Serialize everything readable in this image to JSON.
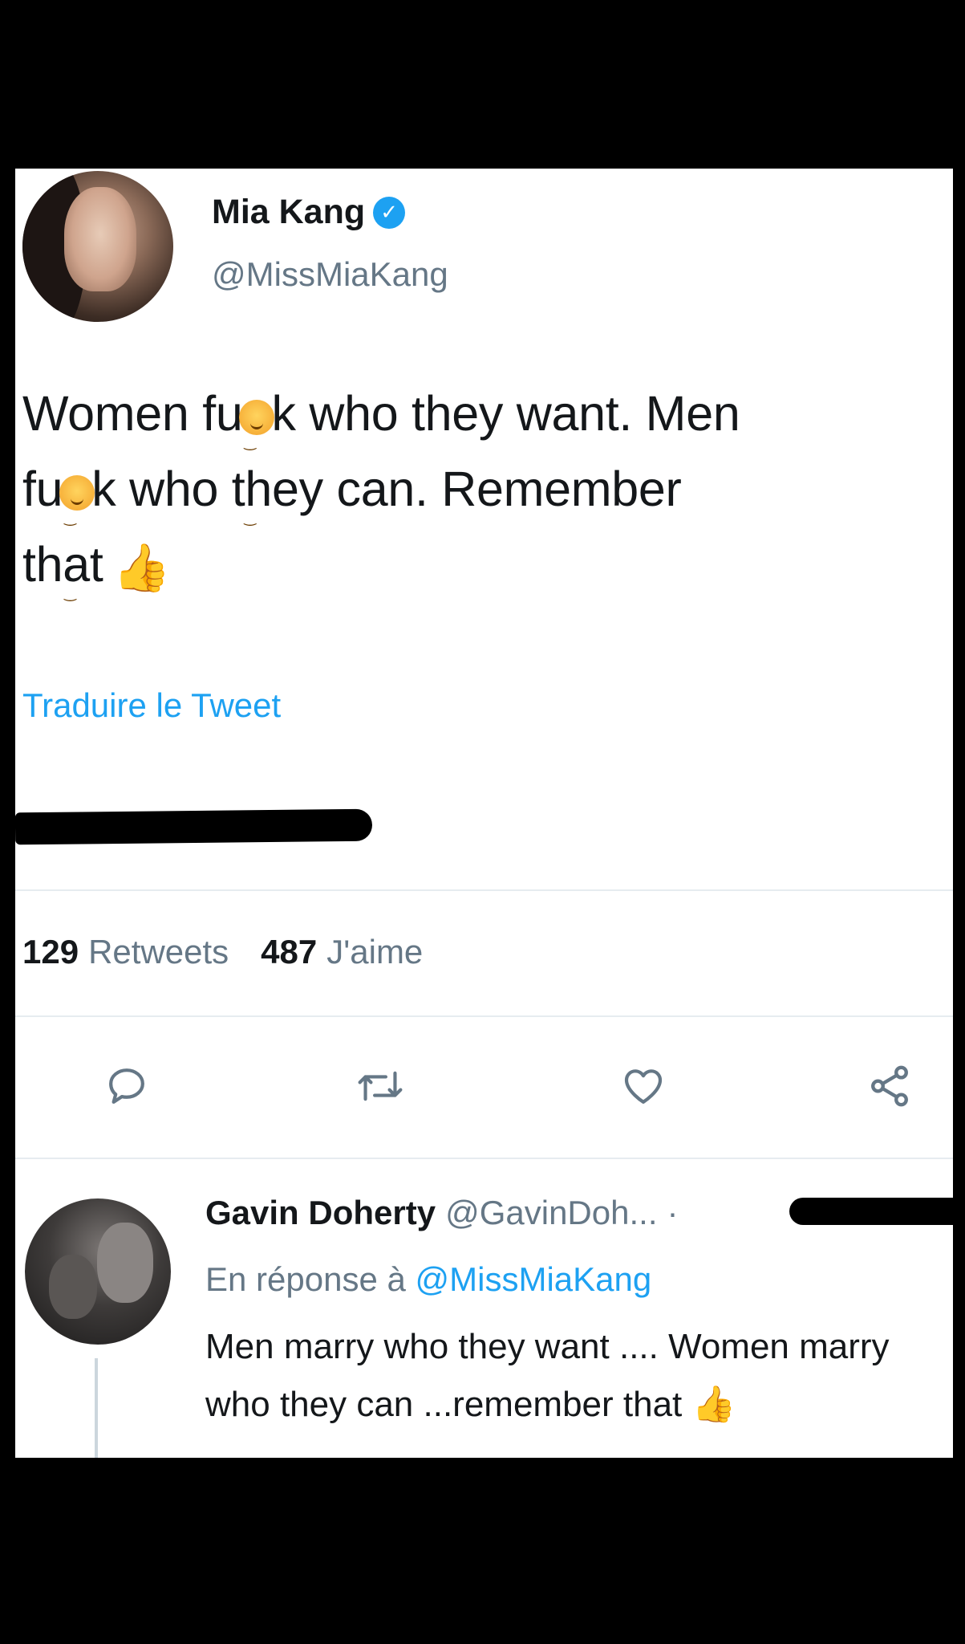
{
  "tweet": {
    "author_name": "Mia Kang",
    "author_handle": "@MissMiaKang",
    "verified_mark": "✓",
    "text_line1_a": "Women fu",
    "text_line1_b": "k who they want. Men",
    "text_line2_a": "fu",
    "text_line2_b": "k who they can. Remember",
    "text_line3": "that",
    "thumb_emoji": "👍",
    "translate_label": "Traduire le Tweet",
    "retweets_count": "129",
    "retweets_label": "Retweets",
    "likes_count": "487",
    "likes_label": "J'aime"
  },
  "icons": {
    "reply": "reply-icon",
    "retweet": "retweet-icon",
    "like": "heart-icon",
    "share": "share-icon"
  },
  "reply": {
    "author_name": "Gavin Doherty",
    "author_handle": "@GavinDoh...",
    "separator": "·",
    "reply_to_prefix": "En réponse à",
    "reply_to_handle": "@MissMiaKang",
    "text": "Men marry who they want .... Women marry who they can ...remember that",
    "thumb_emoji": "👍"
  },
  "colors": {
    "accent": "#1da1f2",
    "muted": "#657786",
    "text": "#14171a"
  }
}
